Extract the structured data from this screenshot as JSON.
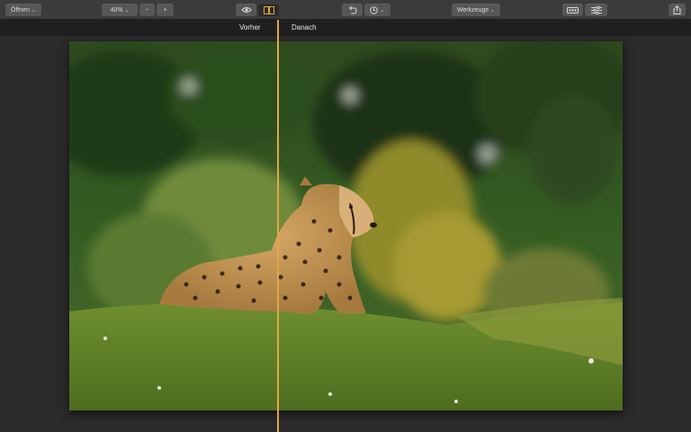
{
  "toolbar": {
    "open_label": "Öffnen",
    "zoom_label": "40%",
    "zoom_out_label": "−",
    "zoom_in_label": "+",
    "tools_label": "Werkzeuge"
  },
  "compare": {
    "before_label": "Vorher",
    "after_label": "Danach"
  },
  "icons": {
    "eye": "eye-icon",
    "split": "split-view-icon",
    "undo": "undo-icon",
    "history": "history-icon",
    "ab": "before-after-icon",
    "adjust": "sliders-icon",
    "share": "share-icon"
  },
  "colors": {
    "divider": "#e2a64a",
    "active_icon": "#e8a33c"
  }
}
